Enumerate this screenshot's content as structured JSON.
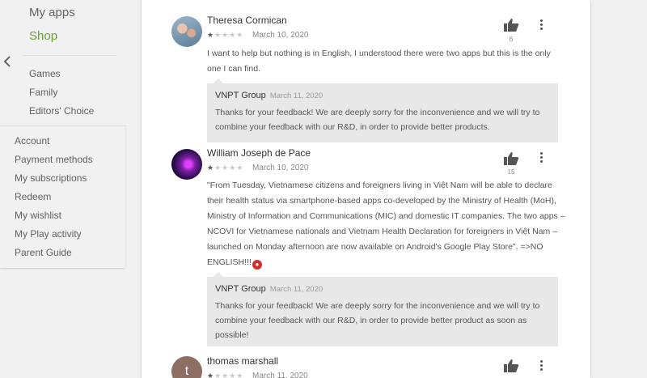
{
  "sidebar": {
    "my_apps": "My apps",
    "shop": "Shop",
    "sub_items": [
      "Games",
      "Family",
      "Editors' Choice"
    ],
    "account_items": [
      "Account",
      "Payment methods",
      "My subscriptions",
      "Redeem",
      "My wishlist",
      "My Play activity",
      "Parent Guide"
    ]
  },
  "reviews": [
    {
      "author": "Theresa Cormican",
      "rating": 1,
      "date": "March 10, 2020",
      "helpful_count": "6",
      "text": "I want to help but nothing is in English, I understood there were two apps but this is the only one I can find.",
      "reply": {
        "author": "VNPT Group",
        "date": "March 11, 2020",
        "text": "Thanks for your feedback! We are deeply sorry for the inconvenience and we will try to combine your feedback with our R&D, in order to provide better products."
      }
    },
    {
      "author": "William Joseph de Pace",
      "rating": 1,
      "date": "March 10, 2020",
      "helpful_count": "15",
      "text": "\"From Tuesday, Vietnamese citizens and foreigners living in Việt Nam will be able to declare their health status via smartphone-based apps co-developed by the Ministry of Health (MoH), Ministry of Information and Communications (MIC) and domestic IT companies. The two apps – NCOVI for Vietnamese nationals and Vietnam Health Declaration for foreigners in Việt Nam – launched on Monday afternoon are now available on Android's Google Play Store\". =>NO ENGLISH!!!",
      "reply": {
        "author": "VNPT Group",
        "date": "March 11, 2020",
        "text": "Thanks for your feedback! We are deeply sorry for the inconvenience and we will try to combine your feedback with our R&D, in order to provide better product as soon as possible!"
      }
    },
    {
      "author": "thomas marshall",
      "rating": 1,
      "date": "March 11, 2020",
      "helpful_count": "",
      "avatar_letter": "t"
    }
  ],
  "colors": {
    "shop_accent": "#689f38",
    "reply_bg": "#e8e8e8",
    "avatar_t": "#8d6e63"
  }
}
